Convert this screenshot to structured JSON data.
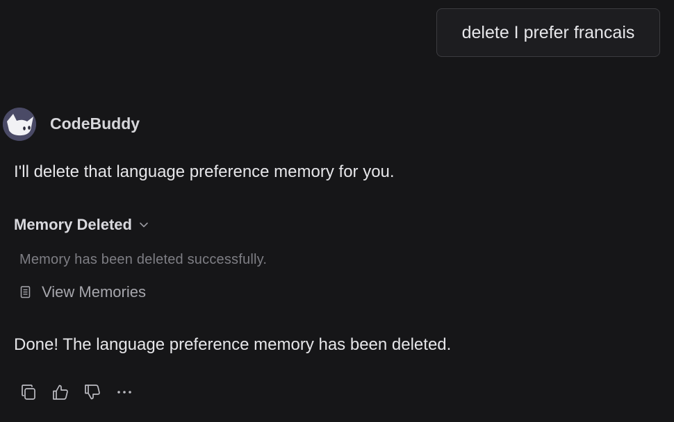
{
  "user_message": {
    "text": "delete I prefer francais"
  },
  "assistant": {
    "name": "CodeBuddy",
    "avatar_icon": "cat-face-icon",
    "intro_text": "I'll delete that language preference memory for you.",
    "memory_panel": {
      "title": "Memory Deleted",
      "expand_icon": "chevron-down-icon",
      "status_text": "Memory has been deleted successfully.",
      "view_link_icon": "document-icon",
      "view_link_label": "View Memories"
    },
    "final_text": "Done! The language preference memory has been deleted."
  },
  "actions": [
    {
      "name": "copy",
      "icon": "copy-icon"
    },
    {
      "name": "like",
      "icon": "thumbs-up-icon"
    },
    {
      "name": "dislike",
      "icon": "thumbs-down-icon"
    },
    {
      "name": "more",
      "icon": "more-icon"
    }
  ],
  "colors": {
    "background": "#161618",
    "bubble_background": "#1d1d20",
    "bubble_border": "#3c3c40",
    "primary_text": "#e6e6e9",
    "muted_text": "#7e7e84",
    "avatar_background": "#4a4a66"
  }
}
